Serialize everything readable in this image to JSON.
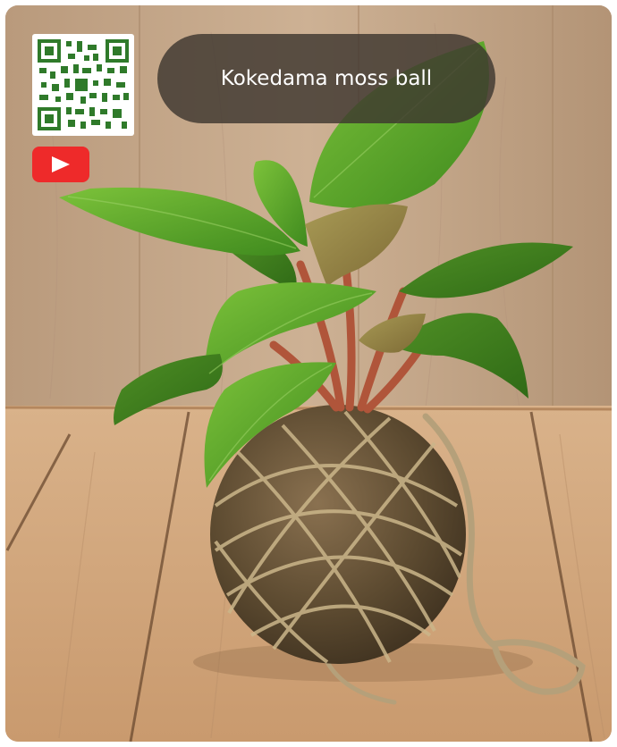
{
  "title": "Kokedama moss ball",
  "icons": {
    "qr": "qr-code-icon",
    "video": "youtube-play-icon"
  },
  "colors": {
    "youtube_red": "#ee2a2a",
    "title_pill": "#3e3730",
    "leaf_green": "#5aa62a",
    "moss_ball": "#6e5a3c",
    "wood_wall": "#c6a88a",
    "wood_table": "#d2a77e"
  }
}
